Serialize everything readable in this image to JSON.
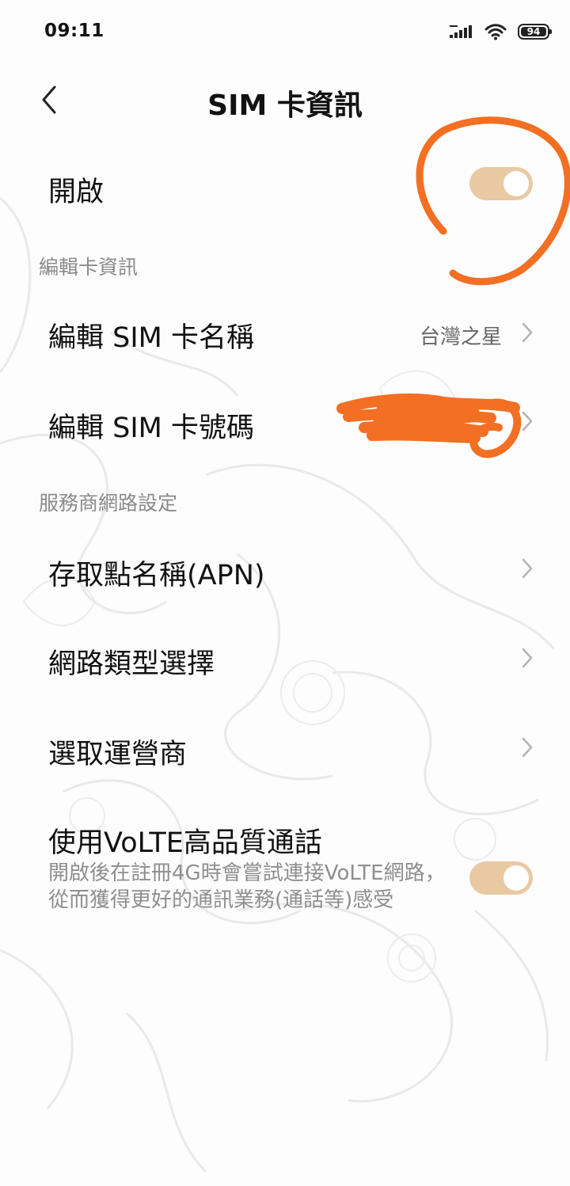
{
  "status_bar": {
    "time": "09:11",
    "battery_level": "94",
    "icons": [
      "signal-icon",
      "wifi-icon",
      "battery-icon"
    ]
  },
  "header": {
    "title": "SIM 卡資訊",
    "back_icon": "chevron-left-icon"
  },
  "enable_row": {
    "label": "開啟",
    "toggle_on": true
  },
  "sections": {
    "edit_card": "編輯卡資訊",
    "carrier_network": "服務商網路設定"
  },
  "rows": {
    "edit_sim_name": {
      "label": "編輯 SIM 卡名稱",
      "value": "台灣之星"
    },
    "edit_sim_number": {
      "label": "編輯 SIM 卡號碼"
    },
    "apn": {
      "label": "存取點名稱(APN)"
    },
    "network_type": {
      "label": "網路類型選擇"
    },
    "carrier": {
      "label": "選取運營商"
    },
    "volte": {
      "label": "使用VoLTE高品質通話",
      "description": "開啟後在註冊4G時會嘗試連接VoLTE網路，從而獲得更好的通訊業務(通話等)感受",
      "toggle_on": true
    }
  },
  "colors": {
    "toggle_on": "#e9c9a2",
    "annotation": "#f36f23",
    "secondary_text": "#8a8a8a"
  }
}
